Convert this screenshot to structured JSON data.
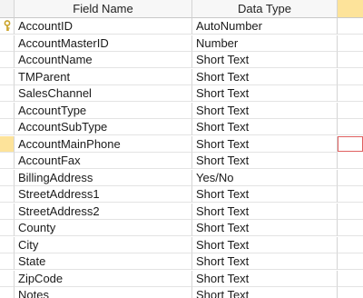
{
  "columns": {
    "field_name": "Field Name",
    "data_type": "Data Type",
    "description": ""
  },
  "accent": {
    "current_row": "#fde39a",
    "focus_border": "#e06060",
    "key_color": "#c9a227"
  },
  "rows": [
    {
      "field": "AccountID",
      "type": "AutoNumber",
      "primary_key": true
    },
    {
      "field": "AccountMasterID",
      "type": "Number"
    },
    {
      "field": "AccountName",
      "type": "Short Text"
    },
    {
      "field": "TMParent",
      "type": "Short Text"
    },
    {
      "field": "SalesChannel",
      "type": "Short Text"
    },
    {
      "field": "AccountType",
      "type": "Short Text"
    },
    {
      "field": "AccountSubType",
      "type": "Short Text"
    },
    {
      "field": "AccountMainPhone",
      "type": "Short Text",
      "current": true
    },
    {
      "field": "AccountFax",
      "type": "Short Text"
    },
    {
      "field": "BillingAddress",
      "type": "Yes/No"
    },
    {
      "field": "StreetAddress1",
      "type": "Short Text"
    },
    {
      "field": "StreetAddress2",
      "type": "Short Text"
    },
    {
      "field": "County",
      "type": "Short Text"
    },
    {
      "field": "City",
      "type": "Short Text"
    },
    {
      "field": "State",
      "type": "Short Text"
    },
    {
      "field": "ZipCode",
      "type": "Short Text"
    },
    {
      "field": "Notes",
      "type": "Short Text"
    }
  ],
  "icons": {
    "primary_key": "key-icon"
  }
}
